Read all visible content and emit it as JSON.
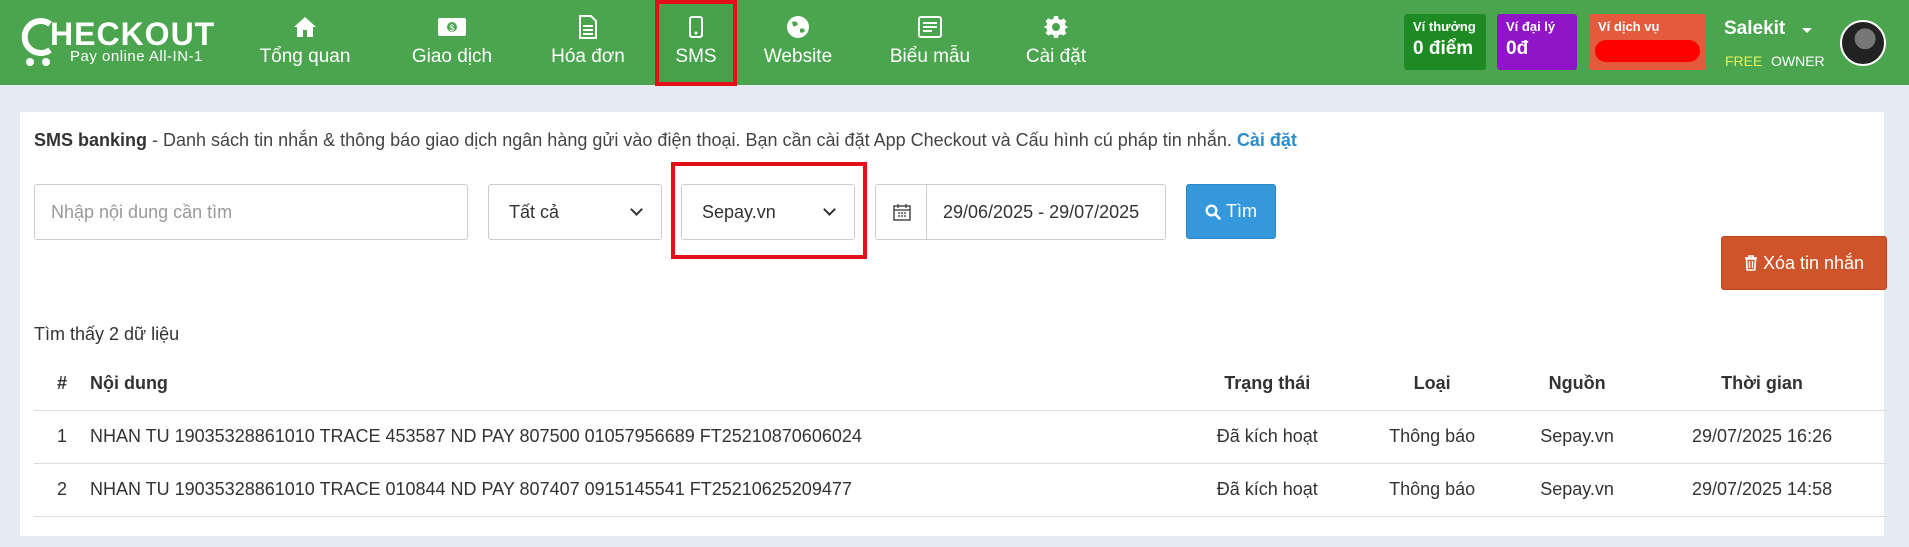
{
  "logo": {
    "text": "HECKOUT",
    "letter": "C",
    "tagline": "Pay online All-IN-1"
  },
  "nav": [
    {
      "label": "Tổng quan",
      "icon": "home-icon"
    },
    {
      "label": "Giao dịch",
      "icon": "money-icon"
    },
    {
      "label": "Hóa đơn",
      "icon": "document-icon"
    },
    {
      "label": "SMS",
      "icon": "mobile-icon",
      "active": true
    },
    {
      "label": "Website",
      "icon": "globe-icon"
    },
    {
      "label": "Biểu mẫu",
      "icon": "form-icon"
    },
    {
      "label": "Cài đặt",
      "icon": "gear-icon"
    }
  ],
  "wallets": {
    "reward": {
      "title": "Ví thưởng",
      "value": "0 điểm",
      "color": "#1e8a23"
    },
    "agent": {
      "title": "Ví đại lý",
      "value": "0đ",
      "color": "#9015c9"
    },
    "service": {
      "title": "Ví dịch vụ",
      "value": "",
      "color": "#e35a3c"
    }
  },
  "user": {
    "name": "Salekit",
    "plan": "FREE",
    "role": "OWNER"
  },
  "description": {
    "title": "SMS banking",
    "text": " - Danh sách tin nhắn & thông báo giao dịch ngân hàng gửi vào điện thoại. Bạn cần cài đặt App Checkout và Cấu hình cú pháp tin nhắn. ",
    "link": "Cài đặt"
  },
  "filters": {
    "search_placeholder": "Nhập nội dung cần tìm",
    "type_value": "Tất cả",
    "source_value": "Sepay.vn",
    "date_range": "29/06/2025 - 29/07/2025",
    "find_label": "Tìm",
    "delete_label": "Xóa tin nhắn"
  },
  "result_text": "Tìm thấy 2 dữ liệu",
  "table": {
    "headers": [
      "#",
      "Nội dung",
      "Trạng thái",
      "Loại",
      "Nguồn",
      "Thời gian"
    ],
    "rows": [
      [
        "1",
        "NHAN TU 19035328861010 TRACE 453587 ND PAY 807500 01057956689 FT25210870606024",
        "Đã kích hoạt",
        "Thông báo",
        "Sepay.vn",
        "29/07/2025 16:26"
      ],
      [
        "2",
        "NHAN TU 19035328861010 TRACE 010844 ND PAY 807407 0915145541 FT25210625209477",
        "Đã kích hoạt",
        "Thông báo",
        "Sepay.vn",
        "29/07/2025 14:58"
      ]
    ]
  }
}
